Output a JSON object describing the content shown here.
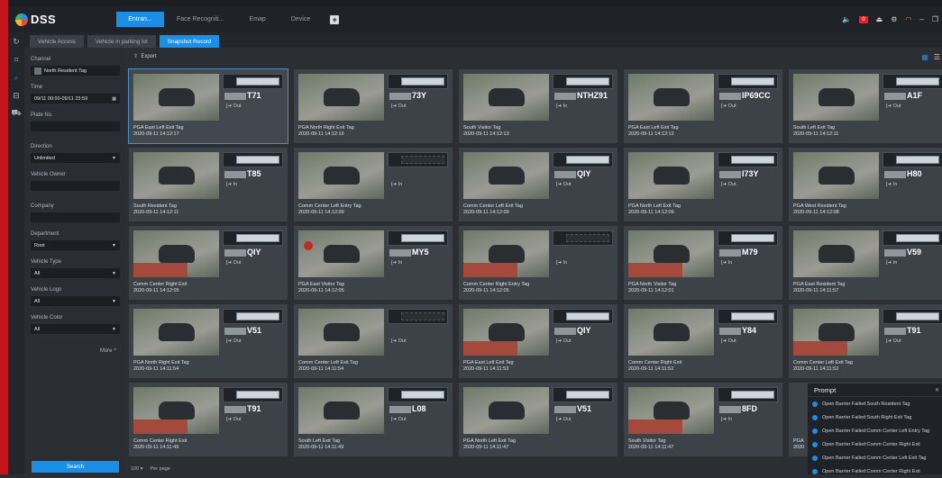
{
  "app": {
    "name": "DSS"
  },
  "top_tabs": [
    "Entran...",
    "Face Recogniti...",
    "Emap",
    "Device"
  ],
  "top_plus": "+",
  "top_right": {
    "alarm_count": "0"
  },
  "sub_tabs": [
    "Vehicle Access",
    "Vehicle in parking lot",
    "Snapshot Record"
  ],
  "filters": {
    "channel_label": "Channel",
    "channel_value": "North Resident Tag",
    "time_label": "Time",
    "time_value": "09/11 00:00-09/11 23:59",
    "plate_label": "Plate No.",
    "direction_label": "Direction",
    "direction_value": "Unlimited",
    "owner_label": "Vehicle Owner",
    "company_label": "Company",
    "department_label": "Department",
    "department_value": "Root",
    "type_label": "Vehicle Type",
    "type_value": "All",
    "logo_label": "Vehicle Logo",
    "logo_value": "All",
    "color_label": "Vehicle Color",
    "color_value": "All",
    "more_label": "More ^",
    "search_label": "Search"
  },
  "toolbar": {
    "export_label": "Export"
  },
  "records": [
    {
      "plate": "T71",
      "dir": "Out",
      "caption": "PGA East Left Exit Tag",
      "time": "2020-09-11 14:12:17"
    },
    {
      "plate": "73Y",
      "dir": "Out",
      "caption": "PGA North Right Exit Tag",
      "time": "2020-09-11 14:12:15"
    },
    {
      "plate": "NTHZ91",
      "dir": "In",
      "caption": "South Visitor Tag",
      "time": "2020-09-11 14:12:13"
    },
    {
      "plate": "IP69CC",
      "dir": "Out",
      "caption": "PGA East Left Exit Tag",
      "time": "2020-09-11 14:12:12"
    },
    {
      "plate": "A1F",
      "dir": "Out",
      "caption": "South Left Exit Tag",
      "time": "2020-09-11 14:12:11"
    },
    {
      "plate": "T85",
      "dir": "In",
      "caption": "South Resident Tag",
      "time": "2020-09-11 14:12:11"
    },
    {
      "plate": "",
      "dir": "In",
      "caption": "Comm Center Left Entry Tag",
      "time": "2020-09-11 14:12:09"
    },
    {
      "plate": "QIY",
      "dir": "Out",
      "caption": "Comm Center Left Exit Tag",
      "time": "2020-09-11 14:12:09"
    },
    {
      "plate": "I73Y",
      "dir": "Out",
      "caption": "PGA North Left Exit Tag",
      "time": "2020-09-11 14:12:09"
    },
    {
      "plate": "H80",
      "dir": "In",
      "caption": "PGA West Resident Tag",
      "time": "2020-09-11 14:12:08"
    },
    {
      "plate": "QIY",
      "dir": "Out",
      "caption": "Comm Center Right Exit",
      "time": "2020-09-11 14:12:05"
    },
    {
      "plate": "MY5",
      "dir": "In",
      "caption": "PGA East Visitor Tag",
      "time": "2020-09-11 14:12:05"
    },
    {
      "plate": "",
      "dir": "In",
      "caption": "Comm Center Right Entry Tag",
      "time": "2020-09-11 14:12:05"
    },
    {
      "plate": "M79",
      "dir": "In",
      "caption": "PGA North Visitor Tag",
      "time": "2020-09-11 14:12:01"
    },
    {
      "plate": "V59",
      "dir": "In",
      "caption": "PGA East Resident Tag",
      "time": "2020-09-11 14:11:57"
    },
    {
      "plate": "V51",
      "dir": "Out",
      "caption": "PGA North Right Exit Tag",
      "time": "2020-09-11 14:11:54"
    },
    {
      "plate": "",
      "dir": "Out",
      "caption": "Comm Center Left Exit Tag",
      "time": "2020-09-11 14:11:54"
    },
    {
      "plate": "QIY",
      "dir": "Out",
      "caption": "PGA East Left Exit Tag",
      "time": "2020-09-11 14:11:53"
    },
    {
      "plate": "Y84",
      "dir": "Out",
      "caption": "Comm Center Right Exit",
      "time": "2020-09-11 14:11:52"
    },
    {
      "plate": "T91",
      "dir": "Out",
      "caption": "Comm Center Left Exit Tag",
      "time": "2020-09-11 14:11:52"
    },
    {
      "plate": "T91",
      "dir": "Out",
      "caption": "Comm Center Right Exit",
      "time": "2020-09-11 14:11:49"
    },
    {
      "plate": "L08",
      "dir": "Out",
      "caption": "South Left Exit Tag",
      "time": "2020-09-11 14:11:49"
    },
    {
      "plate": "V51",
      "dir": "Out",
      "caption": "PGA North Left Exit Tag",
      "time": "2020-09-11 14:11:47"
    },
    {
      "plate": "8FD",
      "dir": "In",
      "caption": "South Visitor Tag",
      "time": "2020-09-11 14:11:47"
    },
    {
      "plate": "",
      "dir": "",
      "caption": "PGA",
      "time": "2020"
    }
  ],
  "footer": {
    "per_page_value": "100",
    "per_page_label": "Per page"
  },
  "prompt": {
    "title": "Prompt",
    "items": [
      "Open Barrier Failed:South Resident Tag",
      "Open Barrier Failed:South Right Exit Tag",
      "Open Barrier Failed:Comm Center Left Entry Tag",
      "Open Barrier Failed:Comm Center Right Exit",
      "Open Barrier Failed:Comm Center Left Exit Tag",
      "Open Barrier Failed:Comm Center Right Exit"
    ]
  }
}
